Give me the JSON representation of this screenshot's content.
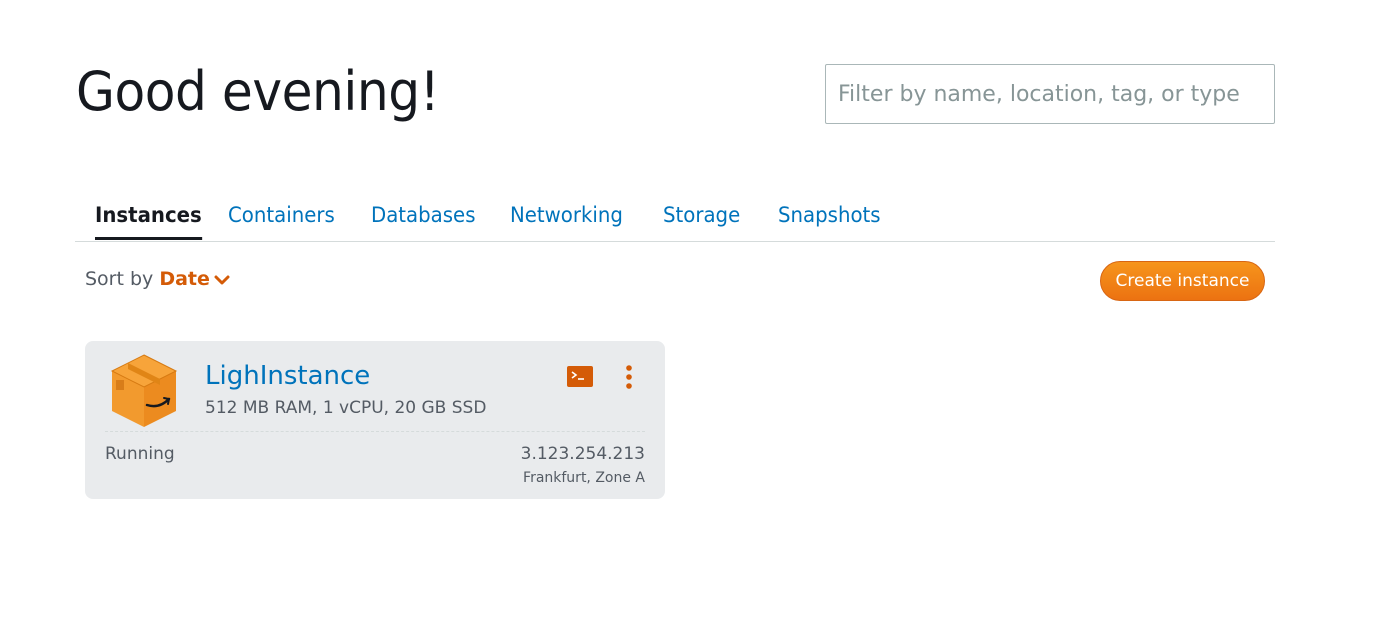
{
  "header": {
    "greeting": "Good evening!",
    "filter_placeholder": "Filter by name, location, tag, or type"
  },
  "tabs": [
    {
      "label": "Instances",
      "active": true
    },
    {
      "label": "Containers",
      "active": false
    },
    {
      "label": "Databases",
      "active": false
    },
    {
      "label": "Networking",
      "active": false
    },
    {
      "label": "Storage",
      "active": false
    },
    {
      "label": "Snapshots",
      "active": false
    }
  ],
  "sort": {
    "prefix": "Sort by",
    "value": "Date"
  },
  "actions": {
    "create_label": "Create instance"
  },
  "instance": {
    "name": "LighInstance",
    "specs": "512 MB RAM, 1 vCPU, 20 GB SSD",
    "status": "Running",
    "ip": "3.123.254.213",
    "location": "Frankfurt, Zone A",
    "icon": "amazon-box-icon"
  },
  "colors": {
    "accent": "#ec7211",
    "link": "#0073bb",
    "text": "#16191f",
    "muted": "#545b64",
    "card_bg": "#e9ebed"
  }
}
